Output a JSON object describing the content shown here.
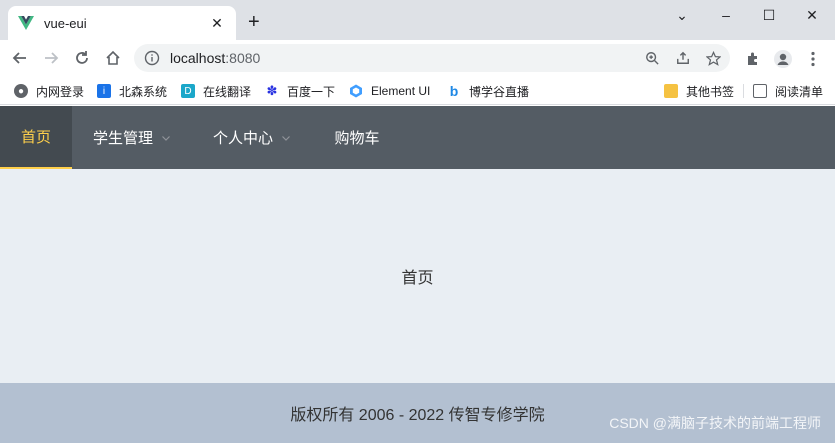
{
  "browser": {
    "tab_title": "vue-eui",
    "tab_close": "✕",
    "new_tab": "+",
    "url_host": "localhost",
    "url_port": ":8080",
    "window": {
      "minimize": "–",
      "maximize": "☐",
      "close": "✕",
      "dropdown": "⌄"
    }
  },
  "bookmarks": [
    {
      "label": "内网登录",
      "icon": "globe-icon",
      "color": "#5f6368"
    },
    {
      "label": "北森系统",
      "icon": "info-icon",
      "color": "#1a73e8"
    },
    {
      "label": "在线翻译",
      "icon": "translate-icon",
      "color": "#1ba7c9"
    },
    {
      "label": "百度一下",
      "icon": "baidu-paw-icon",
      "color": "#2932e1"
    },
    {
      "label": "Element UI",
      "icon": "element-ui-icon",
      "color": "#409eff"
    },
    {
      "label": "博学谷直播",
      "icon": "bxg-icon",
      "color": "#1e88e5"
    },
    {
      "label": "其他书签",
      "icon": "folder-icon",
      "color": "#f5c242"
    },
    {
      "label": "阅读清单",
      "icon": "reading-list-icon",
      "color": "#5f6368"
    }
  ],
  "nav": {
    "items": [
      {
        "label": "首页",
        "active": true,
        "has_submenu": false
      },
      {
        "label": "学生管理",
        "active": false,
        "has_submenu": true
      },
      {
        "label": "个人中心",
        "active": false,
        "has_submenu": true
      },
      {
        "label": "购物车",
        "active": false,
        "has_submenu": false
      }
    ],
    "bg_color": "#545c64",
    "active_color": "#ffd04b"
  },
  "main": {
    "text": "首页",
    "bg_color": "#e9eef3"
  },
  "footer": {
    "text": "版权所有 2006 - 2022 传智专修学院",
    "bg_color": "#b3c0d1"
  },
  "watermark": "CSDN @满脑子技术的前端工程师"
}
